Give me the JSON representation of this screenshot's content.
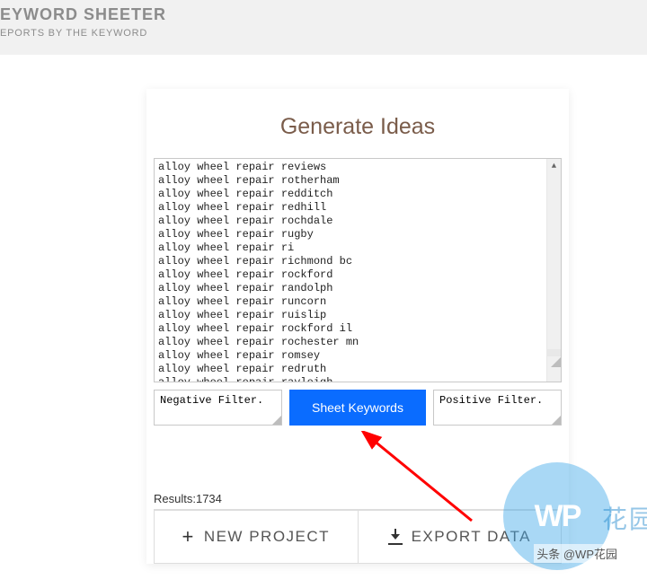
{
  "header": {
    "title": "EYWORD SHEETER",
    "subtitle": "EPORTS BY THE KEYWORD"
  },
  "card": {
    "title": "Generate Ideas",
    "keywords_text": "alloy wheel repair reviews\nalloy wheel repair rotherham\nalloy wheel repair redditch\nalloy wheel repair redhill\nalloy wheel repair rochdale\nalloy wheel repair rugby\nalloy wheel repair ri\nalloy wheel repair richmond bc\nalloy wheel repair rockford\nalloy wheel repair randolph\nalloy wheel repair runcorn\nalloy wheel repair ruislip\nalloy wheel repair rockford il\nalloy wheel repair rochester mn\nalloy wheel repair romsey\nalloy wheel repair redruth\nalloy wheel repair rayleigh",
    "negative_placeholder": "Negative Filter.",
    "positive_placeholder": "Positive Filter.",
    "sheet_button": "Sheet Keywords",
    "results_label": "Results:",
    "results_count": "1734",
    "new_project": "NEW PROJECT",
    "export_data": "EXPORT DATA"
  },
  "watermark": {
    "logo_text": "WP",
    "cn_text": "花园",
    "tag_text": "头条 @WP花园"
  }
}
